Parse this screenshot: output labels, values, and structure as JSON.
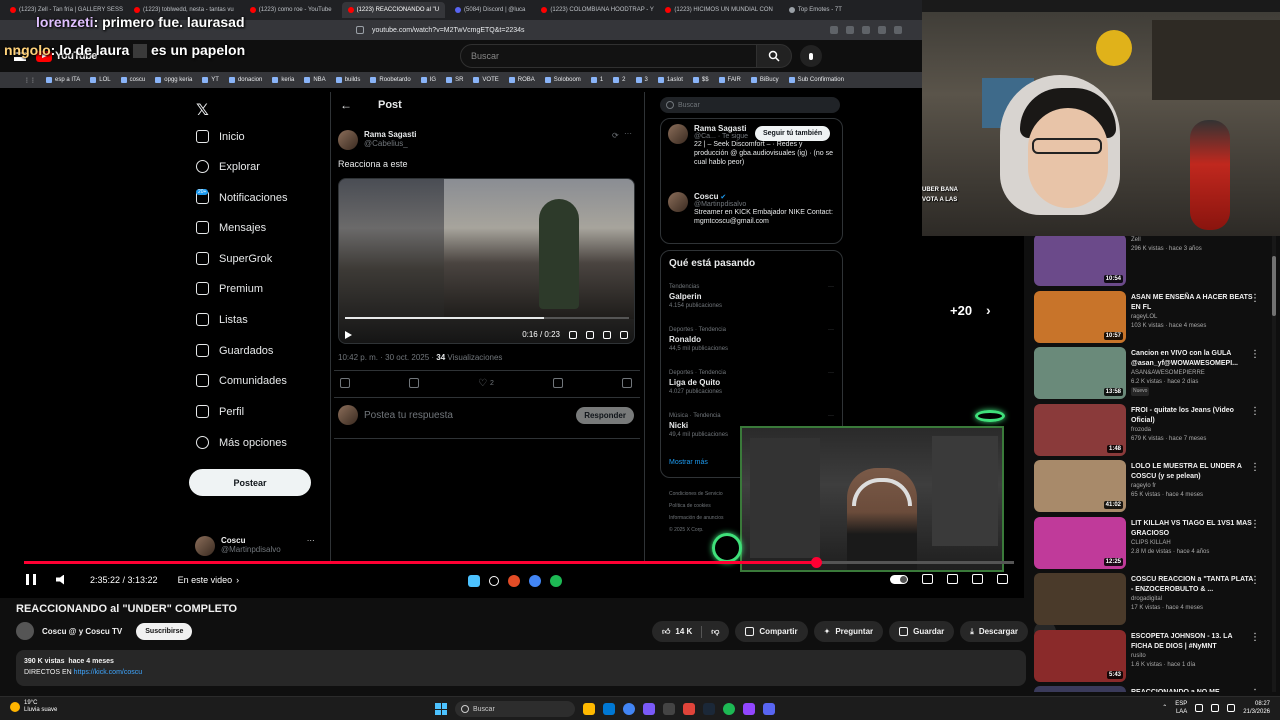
{
  "browser": {
    "tabs": [
      {
        "label": "(1223) Zell - Tan fría | GALLERY SESS",
        "icon": "youtube-icon"
      },
      {
        "label": "(1223) toblwedd, nesta - tantas vu",
        "icon": "youtube-icon"
      },
      {
        "label": "(1223) como roe - YouTube",
        "icon": "youtube-icon"
      },
      {
        "label": "(1223) REACCIONANDO al \"U",
        "icon": "youtube-icon",
        "active": true
      },
      {
        "label": "(5084) Discord | @luca",
        "icon": "discord-icon"
      },
      {
        "label": "(1223) COLOMBIANA HOODTRAP - Y",
        "icon": "youtube-icon"
      },
      {
        "label": "(1223) HICIMOS UN MUNDIAL CON",
        "icon": "youtube-icon"
      },
      {
        "label": "Top Emotes - 7T",
        "icon": "page-icon"
      }
    ],
    "url": "youtube.com/watch?v=M2TwVcmgETQ&t=2234s",
    "bookmarks": [
      "esp a ITA",
      "LOL",
      "coscu",
      "opgg keria",
      "YT",
      "donacion",
      "keria",
      "NBA",
      "builds",
      "Roobetardo",
      "IG",
      "SR",
      "VOTE",
      "ROBA",
      "Soloboom",
      "1",
      "2",
      "3",
      "1aslot",
      "$$",
      "FAIR",
      "BiBucy",
      "Sub Confirmation"
    ]
  },
  "youtube": {
    "logo": "YouTube",
    "search_placeholder": "Buscar"
  },
  "chat": [
    {
      "user": "lorenzeti",
      "text": ": primero fue. laurasad"
    },
    {
      "user": "nngolo",
      "text": ": lo de laura",
      "tail": "es un papelon"
    }
  ],
  "x": {
    "nav": [
      {
        "label": "Inicio",
        "icon": "home-icon"
      },
      {
        "label": "Explorar",
        "icon": "search-icon"
      },
      {
        "label": "Notificaciones",
        "icon": "bell-icon"
      },
      {
        "label": "Mensajes",
        "icon": "mail-icon"
      },
      {
        "label": "SuperGrok",
        "icon": "grok-icon"
      },
      {
        "label": "Premium",
        "icon": "x-logo-icon"
      },
      {
        "label": "Listas",
        "icon": "list-icon"
      },
      {
        "label": "Guardados",
        "icon": "bookmark-icon"
      },
      {
        "label": "Comunidades",
        "icon": "people-icon"
      },
      {
        "label": "Perfil",
        "icon": "person-icon"
      },
      {
        "label": "Más opciones",
        "icon": "more-circle-icon"
      }
    ],
    "notif_badge": "20+",
    "post_button": "Postear",
    "profile": {
      "name": "Coscu",
      "handle": "@Martinpdisalvo"
    },
    "post_header": "Post",
    "post": {
      "author": "Rama Sagasti",
      "handle": "@Cabelius_",
      "text": "Reacciona a este",
      "video_time": "0:16 / 0:23",
      "timestamp": "10:42 p. m. · 30 oct. 2025 · ",
      "views": "34",
      "views_label": "Visualizaciones",
      "likes": "2",
      "reply_placeholder": "Postea tu respuesta",
      "reply_button": "Responder"
    },
    "search_placeholder": "Buscar",
    "suggested": [
      {
        "name": "Rama Sagasti",
        "handle": "@Ca... · Te sigue",
        "bio": "22 | – Seek Discomfort – · Redes y producción @ gba.audiovisuales (ig) · (no se cual hablo peor)"
      },
      {
        "name": "Coscu",
        "handle": "@Martinpdisalvo",
        "bio": "Streamer en KICK Embajador NIKE Contact: mgmtcoscu@gmail.com"
      }
    ],
    "follow_button": "Seguir tú también",
    "trends_title": "Qué está pasando",
    "trends": [
      {
        "category": "Tendencias",
        "name": "Galperin",
        "count": "4.154 publicaciones"
      },
      {
        "category": "Deportes · Tendencia",
        "name": "Ronaldo",
        "count": "44,5 mil publicaciones"
      },
      {
        "category": "Deportes · Tendencia",
        "name": "Liga de Quito",
        "count": "4.027 publicaciones"
      },
      {
        "category": "Música · Tendencia",
        "name": "Nicki",
        "count": "49,4 mil publicaciones"
      }
    ],
    "show_more": "Mostrar más",
    "footer": [
      "Condiciones de Servicio",
      "Política de cookies",
      "Información de anuncios",
      "© 2025 X Corp."
    ]
  },
  "video_overlay": {
    "plus_count": "+20"
  },
  "player": {
    "time": "2:35:22 / 3:13:22",
    "chapter": "En este video",
    "progress": 0.8
  },
  "video": {
    "title": "REACCIONANDO al \"UNDER\" COMPLETO",
    "channel": "Coscu @ y Coscu TV",
    "subscribe": "Suscribirse",
    "likes": "14 K",
    "share": "Compartir",
    "ask": "Preguntar",
    "save": "Guardar",
    "download": "Descargar",
    "views": "390 K vistas",
    "age": "hace 4 meses",
    "desc_prefix": "DIRECTOS EN",
    "desc_link": "https://kick.com/coscu"
  },
  "webcam_overlay": {
    "line1": "UBER BANA",
    "line2": "VOTA A LAS"
  },
  "recommendations": [
    {
      "title": "",
      "channel": "Zell",
      "meta": "296 K vistas · hace 3 años",
      "duration": "10:54",
      "color": "#6b4a8a"
    },
    {
      "title": "ASAN ME ENSEÑA A HACER BEATS EN FL",
      "channel": "rageyLOL",
      "meta": "103 K vistas · hace 4 meses",
      "duration": "10:57",
      "color": "#c8742a"
    },
    {
      "title": "Cancion en VIVO con la GULA @asan_yf@WOWAWESOMEPI...",
      "channel": "ASAN&AWESOMEPIERRE",
      "meta": "6.2 K vistas · hace 2 días",
      "duration": "13:58",
      "color": "#6a8a7a",
      "new": "Nuevo"
    },
    {
      "title": "FROI - quitate los Jeans (Video Oficial)",
      "channel": "frozoda",
      "meta": "679 K vistas · hace 7 meses",
      "duration": "1:48",
      "color": "#8a3a3a"
    },
    {
      "title": "LOLO LE MUESTRA EL UNDER A COSCU (y se pelean)",
      "channel": "rageylo fr",
      "meta": "65 K vistas · hace 4 meses",
      "duration": "41:02",
      "color": "#a88a6a"
    },
    {
      "title": "LIT KILLAH VS TIAGO EL 1VS1 MAS GRACIOSO",
      "channel": "CLIPS KILLAH",
      "meta": "2.8 M de vistas · hace 4 años",
      "duration": "12:25",
      "color": "#c03a9a"
    },
    {
      "title": "COSCU REACCION a \"TANTA PLATA - ENZOCEROBULTO & ...",
      "channel": "drogadigital",
      "meta": "17 K vistas · hace 4 meses",
      "duration": "",
      "color": "#4a3a2a"
    },
    {
      "title": "ESCOPETA JOHNSON - 13. LA FICHA DE DIOS | #NyMNT",
      "channel": "rusito",
      "meta": "1.6 K vistas · hace 1 día",
      "duration": "5:43",
      "color": "#8a2a2a"
    },
    {
      "title": "REACCIONANDO a NO ME",
      "channel": "",
      "meta": "",
      "duration": "",
      "color": "#3a3a5a"
    }
  ],
  "taskbar": {
    "temp": "19°C",
    "weather": "Lluvia suave",
    "search": "Buscar",
    "lang": "ESP",
    "lang2": "LAA",
    "time": "08:27",
    "date": "21/3/2026"
  }
}
